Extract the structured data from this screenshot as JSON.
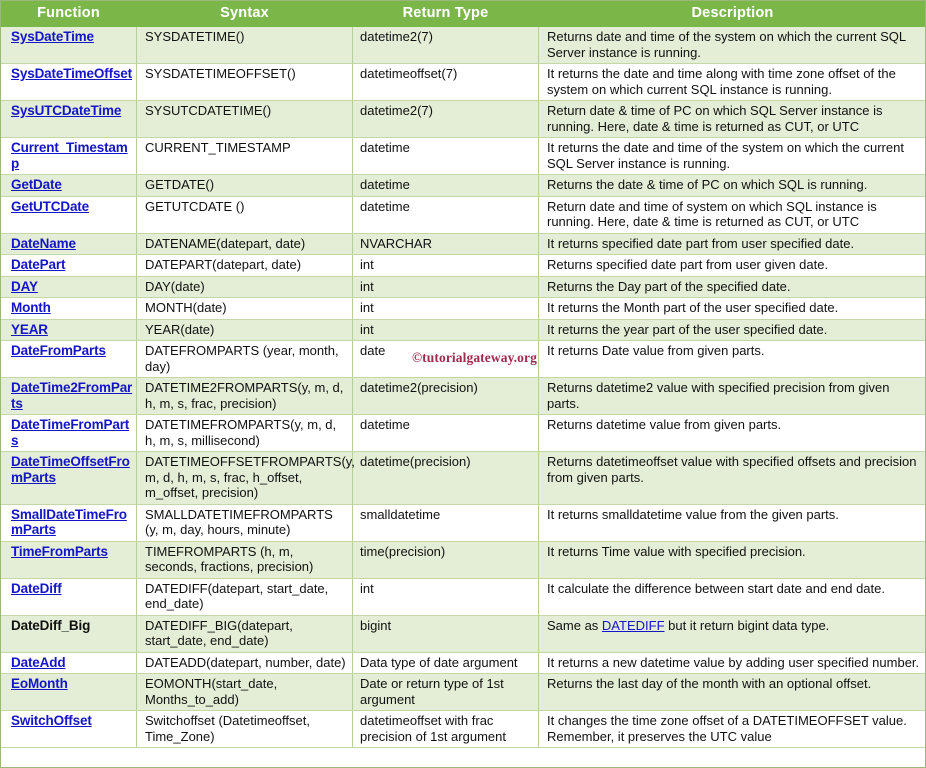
{
  "table": {
    "columns": [
      "Function",
      "Syntax",
      "Return Type",
      "Description"
    ],
    "accent_header_bg": "#7ab648",
    "accent_header_fg": "#ffffff",
    "band_tint_bg": "#e4eed6",
    "band_light_bg": "#ffffff",
    "link_color": "#1414c8",
    "rows": [
      {
        "function": "SysDateTime",
        "function_is_link": true,
        "syntax": "SYSDATETIME()",
        "return_type": "datetime2(7)",
        "description": "Returns date and time of the system on which the current SQL Server instance is running."
      },
      {
        "function": "SysDateTimeOffset",
        "function_is_link": true,
        "syntax": "SYSDATETIMEOFFSET()",
        "return_type": "datetimeoffset(7)",
        "description": "It returns the date and time along with time zone offset of the system on which current SQL instance is running."
      },
      {
        "function": "SysUTCDateTime",
        "function_is_link": true,
        "syntax": "SYSUTCDATETIME()",
        "return_type": "datetime2(7)",
        "description": "Return date & time of PC on which SQL Server instance is running. Here, date & time is returned as CUT, or UTC"
      },
      {
        "function": "Current_Timestamp",
        "function_is_link": true,
        "syntax": "CURRENT_TIMESTAMP",
        "return_type": "datetime",
        "description": "It returns the date and time of the system on which the current SQL Server instance is running."
      },
      {
        "function": "GetDate",
        "function_is_link": true,
        "syntax": "GETDATE()",
        "return_type": "datetime",
        "description": "Returns the date & time of PC on which SQL is running."
      },
      {
        "function": "GetUTCDate",
        "function_is_link": true,
        "syntax": "GETUTCDATE ()",
        "return_type": "datetime",
        "description": "Return date and time of system on which SQL instance is running. Here, date & time is returned as CUT, or UTC"
      },
      {
        "function": "DateName",
        "function_is_link": true,
        "syntax": "DATENAME(datepart, date)",
        "return_type": "NVARCHAR",
        "description": "It returns specified date part from user specified date."
      },
      {
        "function": "DatePart",
        "function_is_link": true,
        "syntax": "DATEPART(datepart, date)",
        "return_type": "int",
        "description": "Returns specified date part from user given date."
      },
      {
        "function": "DAY",
        "function_is_link": true,
        "syntax": "DAY(date)",
        "return_type": "int",
        "description": "Returns the Day part of the specified date."
      },
      {
        "function": "Month",
        "function_is_link": true,
        "syntax": "MONTH(date)",
        "return_type": "int",
        "description": "It returns the Month part of the user specified date."
      },
      {
        "function": "YEAR",
        "function_is_link": true,
        "syntax": "YEAR(date)",
        "return_type": "int",
        "description": "It returns the year part of the user specified date."
      },
      {
        "function": "DateFromParts",
        "function_is_link": true,
        "syntax": "DATEFROMPARTS (year, month, day)",
        "return_type": "date",
        "description": "It returns Date value from given parts."
      },
      {
        "function": "DateTime2FromParts",
        "function_is_link": true,
        "syntax": "DATETIME2FROMPARTS(y, m, d, h, m, s, frac, precision)",
        "return_type": "datetime2(precision)",
        "description": "Returns datetime2 value with specified precision from given parts."
      },
      {
        "function": "DateTimeFromParts",
        "function_is_link": true,
        "syntax": "DATETIMEFROMPARTS(y, m, d, h, m, s, millisecond)",
        "return_type": "datetime",
        "description": "Returns datetime value from given parts."
      },
      {
        "function": "DateTimeOffsetFromParts",
        "function_is_link": true,
        "syntax": "DATETIMEOFFSETFROMPARTS(y, m, d, h, m, s, frac, h_offset, m_offset, precision)",
        "return_type": "datetime(precision)",
        "description": "Returns datetimeoffset value with specified offsets and precision from given parts."
      },
      {
        "function": "SmallDateTimeFromParts",
        "function_is_link": true,
        "syntax": "SMALLDATETIMEFROMPARTS (y, m, day, hours, minute)",
        "return_type": "smalldatetime",
        "description": "It returns smalldatetime value from the given parts."
      },
      {
        "function": "TimeFromParts",
        "function_is_link": true,
        "syntax": "TIMEFROMPARTS (h, m, seconds, fractions, precision)",
        "return_type": "time(precision)",
        "description": "It returns Time value with specified precision."
      },
      {
        "function": "DateDiff",
        "function_is_link": true,
        "syntax": "DATEDIFF(datepart, start_date, end_date)",
        "return_type": "int",
        "description": "It calculate the difference between start date and end date."
      },
      {
        "function": "DateDiff_Big",
        "function_is_link": false,
        "syntax": "DATEDIFF_BIG(datepart, start_date, end_date)",
        "return_type": "bigint",
        "description": "Same as DATEDIFF but it return bigint data type.",
        "description_link_text": "DATEDIFF"
      },
      {
        "function": "DateAdd",
        "function_is_link": true,
        "syntax": "DATEADD(datepart, number, date)",
        "return_type": "Data type of date argument",
        "description": "It returns a new datetime value by adding user specified number."
      },
      {
        "function": "EoMonth",
        "function_is_link": true,
        "syntax": "EOMONTH(start_date, Months_to_add)",
        "return_type": "Date or return type of 1st argument",
        "description": "Returns the last day of the month with an optional offset."
      },
      {
        "function": "SwitchOffset",
        "function_is_link": true,
        "syntax": "Switchoffset (Datetimeoffset, Time_Zone)",
        "return_type": "datetimeoffset with frac precision of 1st argument",
        "description": "It changes the time zone offset of a DATETIMEOFFSET value. Remember, it preserves the UTC value"
      }
    ]
  },
  "watermark": {
    "text": "©tutorialgateway.org",
    "color": "#9e2b4e"
  }
}
